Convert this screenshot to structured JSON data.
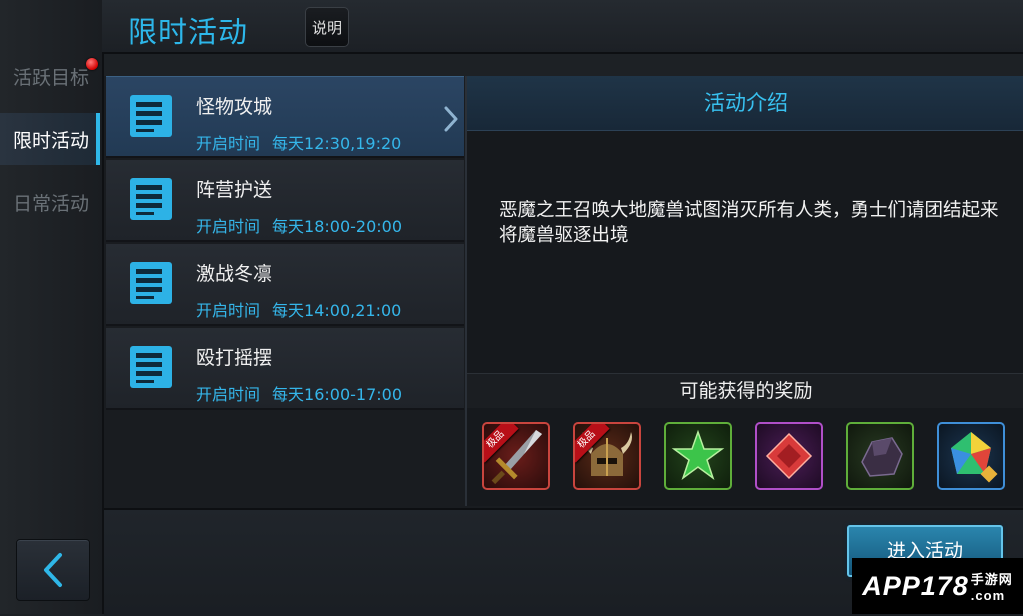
{
  "sidebar": {
    "items": [
      {
        "label": "活跃目标",
        "has_badge": true
      },
      {
        "label": "限时活动",
        "active": true
      },
      {
        "label": "日常活动"
      }
    ],
    "back_icon": "chevron-left-icon"
  },
  "header": {
    "title": "限时活动",
    "help_label": "说明"
  },
  "activities": [
    {
      "name": "怪物攻城",
      "time_label": "开启时间",
      "time": "每天12:30,19:20",
      "selected": true
    },
    {
      "name": "阵营护送",
      "time_label": "开启时间",
      "time": "每天18:00-20:00"
    },
    {
      "name": "激战冬凛",
      "time_label": "开启时间",
      "time": "每天14:00,21:00"
    },
    {
      "name": "殴打摇摆",
      "time_label": "开启时间",
      "time": "每天16:00-17:00"
    }
  ],
  "detail": {
    "title": "活动介绍",
    "description": "恶魔之王召唤大地魔兽试图消灭所有人类，勇士们请团结起来将魔兽驱逐出境",
    "rewards_title": "可能获得的奖励",
    "rewards": [
      {
        "icon": "sword-icon",
        "tag": "极品",
        "border": "#c9453e"
      },
      {
        "icon": "helmet-icon",
        "tag": "极品",
        "border": "#c9453e"
      },
      {
        "icon": "green-star-icon",
        "border": "#5fae3a"
      },
      {
        "icon": "red-gem-icon",
        "border": "#b04fc8"
      },
      {
        "icon": "dark-ore-icon",
        "border": "#5fae3a"
      },
      {
        "icon": "rainbow-crystal-icon",
        "border": "#3f8fd8"
      }
    ]
  },
  "actions": {
    "enter_label": "进入活动"
  },
  "watermark": {
    "brand": "APP178",
    "site": "手游网",
    "domain": ".com"
  }
}
